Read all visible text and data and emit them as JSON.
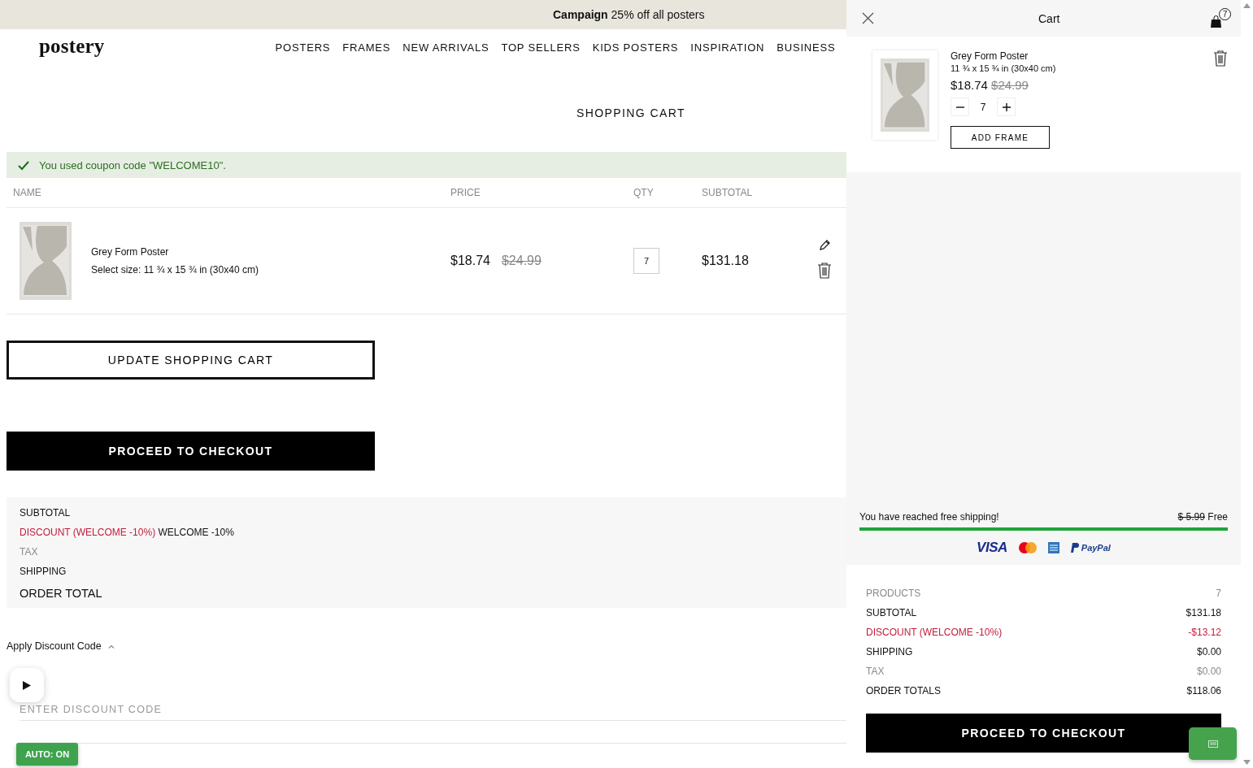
{
  "banner": {
    "text": "**Campaign** 25% off all posters"
  },
  "header": {
    "logo": "postery",
    "nav": [
      "POSTERS",
      "FRAMES",
      "NEW ARRIVALS",
      "TOP SELLERS",
      "KIDS POSTERS",
      "INSPIRATION",
      "BUSINESS"
    ]
  },
  "page_title": "SHOPPING CART",
  "message": {
    "kind": "success",
    "text": "You used coupon code \"WELCOME10\"."
  },
  "table": {
    "columns": [
      "NAME",
      "PRICE",
      "QTY",
      "SUBTOTAL"
    ],
    "rows": [
      {
        "name": "Grey Form Poster",
        "size": "Select size: 11 ¾ x 15 ¾ in (30x40 cm)",
        "price": "$18.74",
        "old_price": "$24.99",
        "qty": "7",
        "subtotal": "$131.18"
      }
    ]
  },
  "update_button": "UPDATE SHOPPING CART",
  "checkout_button": "PROCEED TO CHECKOUT",
  "summary": [
    {
      "label": "SUBTOTAL",
      "kind": "line",
      "color": "#111111"
    },
    {
      "label": "DISCOUNT (WELCOME -10%)",
      "kind": "line",
      "color": "#c21c3a",
      "value": "WELCOME -10%"
    },
    {
      "label": "TAX",
      "kind": "line",
      "color": "#8a8a8a"
    },
    {
      "label": "SHIPPING",
      "kind": "line",
      "color": "#111111"
    },
    {
      "label": "ORDER TOTAL",
      "kind": "total",
      "color": "#111111"
    }
  ],
  "discount": {
    "toggle": "Apply Discount Code",
    "expanded": true,
    "label": "ENTER DISCOUNT CODE"
  },
  "drawer": {
    "title": "Cart",
    "cart_count": "7",
    "item": {
      "name": "Grey Form Poster",
      "size": "11 ¾ x 15 ¾ in (30x40 cm)",
      "price": "$18.74",
      "old_price": "$24.99",
      "qty": "7",
      "frame_button": "ADD FRAME"
    },
    "shipping": {
      "message": "You have reached free shipping!",
      "old_cost": "$ 5.99",
      "cost": "Free",
      "level": 1
    },
    "payment_logos": [
      {
        "kind": "visa",
        "text": "VISA"
      },
      {
        "kind": "mastercard"
      },
      {
        "kind": "amex"
      },
      {
        "kind": "paypal",
        "text": "PayPal"
      }
    ],
    "totals": [
      {
        "label": "PRODUCTS",
        "value": "7",
        "color": "#8a8a8a"
      },
      {
        "label": "SUBTOTAL",
        "value": "$131.18",
        "color": "#111111"
      },
      {
        "label": "DISCOUNT (WELCOME -10%)",
        "value": "-$13.12",
        "color": "#c21c3a"
      },
      {
        "label": "SHIPPING",
        "value": "$0.00",
        "color": "#111111"
      },
      {
        "label": "TAX",
        "value": "$0.00",
        "color": "#8a8a8a"
      },
      {
        "label": "ORDER TOTALS",
        "value": "$118.06",
        "color": "#111111"
      }
    ],
    "checkout_button": "PROCEED TO CHECKOUT"
  },
  "overlays": {
    "auto_button": "AUTO: ON"
  }
}
